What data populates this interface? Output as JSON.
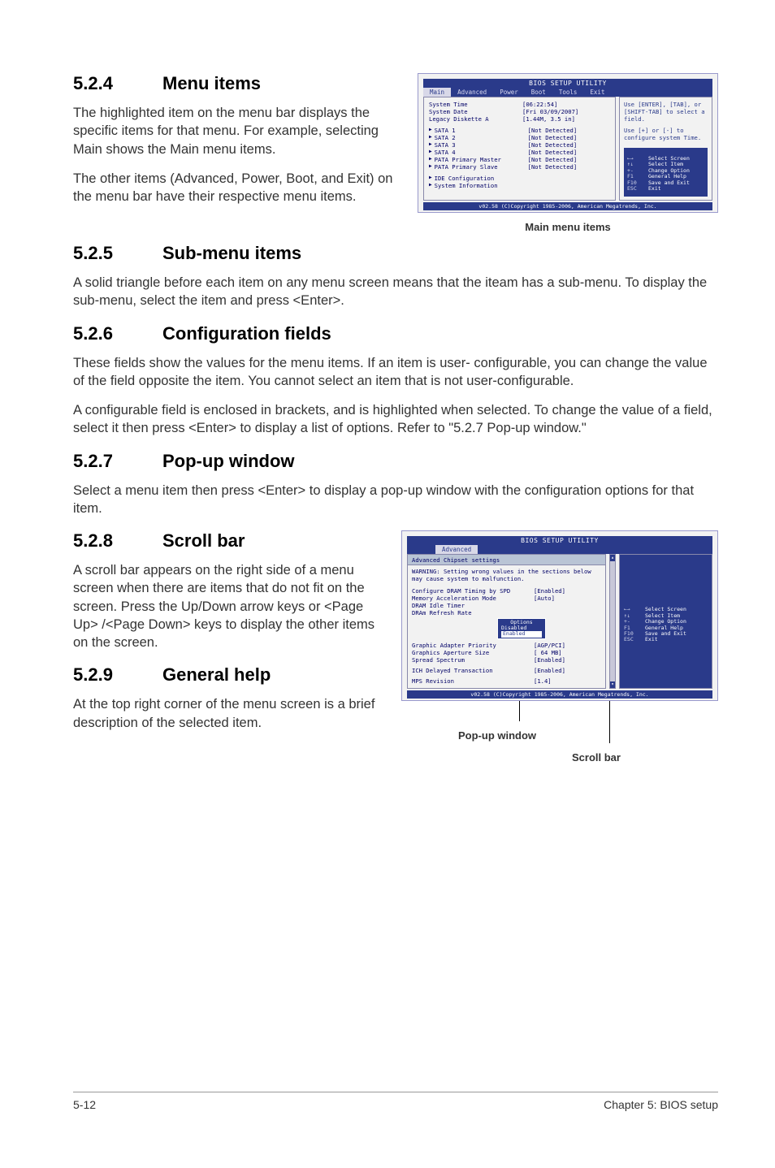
{
  "sections": {
    "s524": {
      "num": "5.2.4",
      "title": "Menu items",
      "p1": "The highlighted item on the menu bar displays the specific items for that menu. For example, selecting Main shows the Main menu items.",
      "p2": "The other items (Advanced, Power, Boot, and Exit) on the menu bar have their respective menu items."
    },
    "s525": {
      "num": "5.2.5",
      "title": "Sub-menu items",
      "p1": "A solid triangle before each item on any menu screen means that the iteam has a sub-menu. To display the sub-menu, select the item and press <Enter>."
    },
    "s526": {
      "num": "5.2.6",
      "title": "Configuration fields",
      "p1": "These fields show the values for the menu items. If an item is user- configurable, you can change the value of the field opposite the item. You cannot select an item that is not user-configurable.",
      "p2": "A configurable field is enclosed in brackets, and is highlighted when selected. To change the value of a field, select it then press <Enter> to display a list of options. Refer to \"5.2.7 Pop-up window.\""
    },
    "s527": {
      "num": "5.2.7",
      "title": "Pop-up window",
      "p1": "Select a menu item then press <Enter> to display a pop-up window with the configuration options for that item."
    },
    "s528": {
      "num": "5.2.8",
      "title": "Scroll bar",
      "p1": "A scroll bar appears on the right side of a menu screen when there are items that do not fit on the screen. Press the Up/Down arrow keys or <Page Up> /<Page Down> keys to display the other items on the screen."
    },
    "s529": {
      "num": "5.2.9",
      "title": "General help",
      "p1": "At the top right corner of the menu screen is a brief description of the selected item."
    }
  },
  "bios1": {
    "title": "BIOS SETUP UTILITY",
    "menubar": [
      "Main",
      "Advanced",
      "Power",
      "Boot",
      "Tools",
      "Exit"
    ],
    "fields": [
      {
        "label": "System Time",
        "value": "[06:22:54]"
      },
      {
        "label": "System Date",
        "value": "[Fri 03/09/2007]"
      },
      {
        "label": "Legacy Diskette A",
        "value": "[1.44M, 3.5 in]"
      }
    ],
    "sub": [
      {
        "label": "SATA 1",
        "value": "[Not Detected]"
      },
      {
        "label": "SATA 2",
        "value": "[Not Detected]"
      },
      {
        "label": "SATA 3",
        "value": "[Not Detected]"
      },
      {
        "label": "SATA 4",
        "value": "[Not Detected]"
      },
      {
        "label": "PATA Primary Master",
        "value": "[Not Detected]"
      },
      {
        "label": "PATA Primary Slave",
        "value": "[Not Detected]"
      }
    ],
    "sub2": [
      "IDE Configuration",
      "System Information"
    ],
    "help1": "Use [ENTER], [TAB], or [SHIFT-TAB] to select a field.",
    "help2": "Use [+] or [-] to configure system Time.",
    "keys": [
      {
        "k": "←→",
        "t": "Select Screen"
      },
      {
        "k": "↑↓",
        "t": "Select Item"
      },
      {
        "k": "+-",
        "t": "Change Option"
      },
      {
        "k": "F1",
        "t": "General Help"
      },
      {
        "k": "F10",
        "t": "Save and Exit"
      },
      {
        "k": "ESC",
        "t": "Exit"
      }
    ],
    "copyright": "v02.58 (C)Copyright 1985-2006, American Megatrends, Inc.",
    "caption": "Main menu items"
  },
  "bios2": {
    "title": "BIOS SETUP UTILITY",
    "tab": "Advanced",
    "header": "Advanced Chipset settings",
    "warning": "WARNING: Setting wrong values in the sections below may cause system to malfunction.",
    "fields": [
      {
        "label": "Configure DRAM Timing by SPD",
        "value": "[Enabled]"
      },
      {
        "label": "Memory Acceleration Mode",
        "value": "[Auto]"
      },
      {
        "label": "DRAM Idle Timer",
        "value": ""
      },
      {
        "label": "DRAm Refresh Rate",
        "value": ""
      }
    ],
    "popup": {
      "top": "Options",
      "mid": "Disabled",
      "sel": "Enabled"
    },
    "fields2": [
      {
        "label": "Graphic Adapter Priority",
        "value": "[AGP/PCI]"
      },
      {
        "label": "Graphics Aperture Size",
        "value": "[ 64 MB]"
      },
      {
        "label": "Spread Spectrum",
        "value": "[Enabled]"
      }
    ],
    "fields3": [
      {
        "label": "ICH Delayed Transaction",
        "value": "[Enabled]"
      }
    ],
    "fields4": [
      {
        "label": "MPS Revision",
        "value": "[1.4]"
      }
    ],
    "keys": [
      {
        "k": "←→",
        "t": "Select Screen"
      },
      {
        "k": "↑↓",
        "t": "Select Item"
      },
      {
        "k": "+-",
        "t": "Change Option"
      },
      {
        "k": "F1",
        "t": "General Help"
      },
      {
        "k": "F10",
        "t": "Save and Exit"
      },
      {
        "k": "ESC",
        "t": "Exit"
      }
    ],
    "copyright": "v02.58 (C)Copyright 1985-2006, American Megatrends, Inc.",
    "cap_popup": "Pop-up window",
    "cap_scroll": "Scroll bar"
  },
  "footer": {
    "left": "5-12",
    "right": "Chapter 5: BIOS setup"
  }
}
